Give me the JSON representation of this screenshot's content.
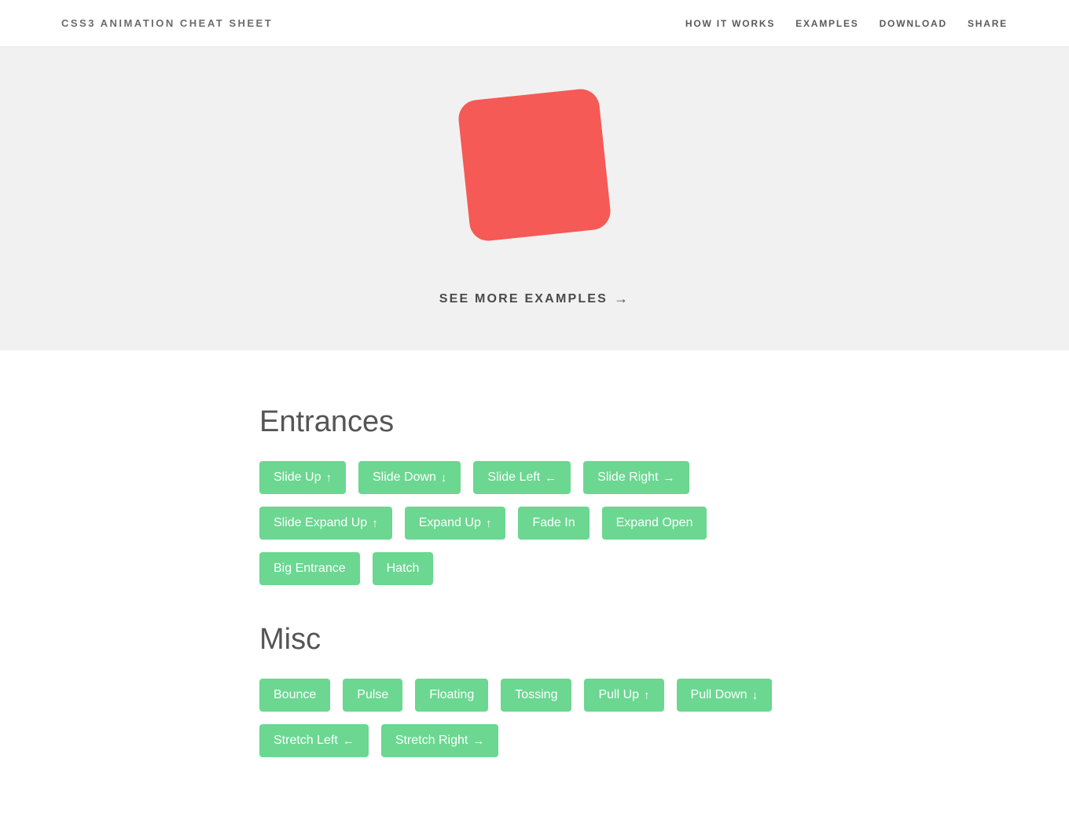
{
  "header": {
    "brand": "CSS3 ANIMATION CHEAT SHEET",
    "nav": [
      "HOW IT WORKS",
      "EXAMPLES",
      "DOWNLOAD",
      "SHARE"
    ]
  },
  "hero": {
    "see_more": "SEE MORE EXAMPLES",
    "arrow": "→"
  },
  "sections": {
    "entrances": {
      "title": "Entrances",
      "buttons": [
        {
          "label": "Slide Up",
          "icon": "↑"
        },
        {
          "label": "Slide Down",
          "icon": "↓"
        },
        {
          "label": "Slide Left",
          "icon": "←"
        },
        {
          "label": "Slide Right",
          "icon": "→"
        },
        {
          "label": "Slide Expand Up",
          "icon": "↑"
        },
        {
          "label": "Expand Up",
          "icon": "↑"
        },
        {
          "label": "Fade In",
          "icon": ""
        },
        {
          "label": "Expand Open",
          "icon": ""
        },
        {
          "label": "Big Entrance",
          "icon": ""
        },
        {
          "label": "Hatch",
          "icon": ""
        }
      ]
    },
    "misc": {
      "title": "Misc",
      "buttons": [
        {
          "label": "Bounce",
          "icon": ""
        },
        {
          "label": "Pulse",
          "icon": ""
        },
        {
          "label": "Floating",
          "icon": ""
        },
        {
          "label": "Tossing",
          "icon": ""
        },
        {
          "label": "Pull Up",
          "icon": "↑"
        },
        {
          "label": "Pull Down",
          "icon": "↓"
        },
        {
          "label": "Stretch Left",
          "icon": "←"
        },
        {
          "label": "Stretch Right",
          "icon": "→"
        }
      ]
    }
  }
}
